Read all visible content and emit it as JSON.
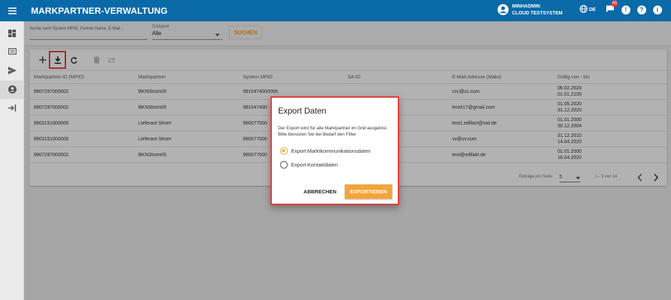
{
  "header": {
    "title": "MARKPARTNER-VERWALTUNG",
    "user_name": "MINHADMIN",
    "system_name": "CLOUD TESTSYSTEM",
    "language": "DE",
    "notification_count": "65"
  },
  "sidebar": {
    "items": [
      {
        "icon": "dashboard-icon"
      },
      {
        "icon": "message-list-icon"
      },
      {
        "icon": "send-icon"
      },
      {
        "icon": "account-icon",
        "active": true
      },
      {
        "icon": "logout-icon"
      }
    ]
  },
  "filters": {
    "search_placeholder": "Suche nach System MPID, Partner-Name, E-Mail...",
    "validity_label": "Gültigkeit",
    "validity_value": "Alle",
    "search_button": "SUCHEN"
  },
  "table": {
    "columns": [
      "Marktpartner-ID (MPID)",
      "Marktpartner",
      "System MPID",
      "SA-ID",
      "E-Mail-Adresse (Mako)",
      "Gültig von - bis"
    ],
    "rows": [
      {
        "mpid": "9907297000002",
        "partner": "BKNStrom05",
        "system_mpid": "9910474000000",
        "sa_id": "",
        "email": "ccc@cc.com",
        "valid_from": "06.02.2024",
        "valid_to": "01.01.2100"
      },
      {
        "mpid": "9907297000002",
        "partner": "BKNStrom05",
        "system_mpid": "991047400",
        "sa_id": "",
        "email": "test417@gmail.com",
        "valid_from": "01.05.2020",
        "valid_to": "31.12.2020"
      },
      {
        "mpid": "9903151000005",
        "partner": "Lieferant Strom",
        "system_mpid": "990077000",
        "sa_id": "",
        "email": "test1.edifact@swl.de",
        "valid_from": "01.01.2000",
        "valid_to": "30.12.2004"
      },
      {
        "mpid": "9903151000005",
        "partner": "Lieferant Strom",
        "system_mpid": "990077000",
        "sa_id": "",
        "email": "vv@vv.com",
        "valid_from": "31.12.2010",
        "valid_to": "14.04.2020"
      },
      {
        "mpid": "9907297000002",
        "partner": "BKNStrom05",
        "system_mpid": "990077000",
        "sa_id": "",
        "email": "test@edifakt.de",
        "valid_from": "01.01.2000",
        "valid_to": "16.04.2020"
      }
    ]
  },
  "paginator": {
    "label": "Einträge pro Seite:",
    "page_size": "5",
    "range": "1 - 5 von 14"
  },
  "dialog": {
    "title": "Export Daten",
    "text": "Der Export wird für alle Marktpartner im Grid ausgelöst. Bitte benutzen Sie bei Bedarf den Filter.",
    "options": [
      {
        "label": "Export Marktkommunikationsdaten",
        "selected": true
      },
      {
        "label": "Export Kontaktdaten",
        "selected": false
      }
    ],
    "cancel_label": "ABBRECHEN",
    "export_label": "EXPORTIEREN"
  },
  "colors": {
    "primary": "#0a6aa8",
    "accent": "#f5a43a",
    "highlight": "#e53935"
  }
}
